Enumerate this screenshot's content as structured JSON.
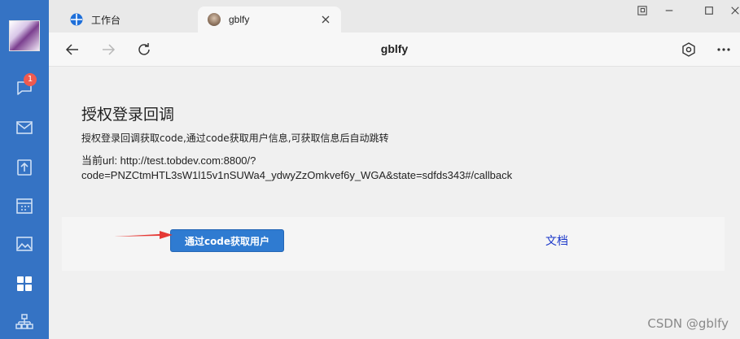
{
  "sidebar": {
    "items": [
      {
        "icon": "chat-icon",
        "badge": "1"
      },
      {
        "icon": "mail-icon"
      },
      {
        "icon": "upload-icon"
      },
      {
        "icon": "calendar-icon"
      },
      {
        "icon": "image-icon"
      },
      {
        "icon": "apps-grid-icon"
      },
      {
        "icon": "org-chart-icon"
      }
    ]
  },
  "tabs": [
    {
      "label": "工作台",
      "icon": "workbench-icon"
    },
    {
      "label": "gblfy",
      "icon": "profile-favicon-icon",
      "active": true
    }
  ],
  "nav": {
    "title": "gblfy"
  },
  "content": {
    "heading": "授权登录回调",
    "description": "授权登录回调获取code,通过code获取用户信息,可获取信息后自动跳转",
    "url_line1": "当前url: http://test.tobdev.com:8800/?",
    "url_line2": "code=PNZCtmHTL3sW1l15v1nSUWa4_ydwyZzOmkvef6y_WGA&state=sdfds343#/callback",
    "button_label": "通过code获取用户",
    "doc_link": "文档"
  },
  "watermark": "CSDN @gblfy",
  "colors": {
    "rail": "#3573c4",
    "button": "#2f7bd1",
    "link": "#1a37c9",
    "arrow": "#e53935"
  }
}
